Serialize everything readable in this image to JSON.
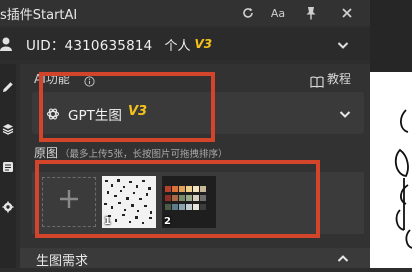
{
  "window": {
    "title": "s插件StartAI"
  },
  "account": {
    "uid": "UID：4310635814",
    "plan": "个人",
    "plan_badge": "V3"
  },
  "feature": {
    "label": "AI功能",
    "tutorial_label": "教程",
    "selected": "GPT生图",
    "selected_badge": "V3"
  },
  "upload": {
    "label": "原图",
    "hint": "（最多上传5张，长按图片可拖拽排序）",
    "images": [
      {
        "index": "1"
      },
      {
        "index": "2"
      }
    ]
  },
  "section_next": {
    "label": "生图需求"
  },
  "colors": {
    "accent_badge": "#f5c21b",
    "annotation": "#d2452a",
    "panel_bg": "#323232"
  },
  "icons": [
    "refresh-icon",
    "font-size-icon",
    "pin-icon",
    "close-icon",
    "user-icon",
    "chevron-down-icon",
    "edit-icon",
    "layers-icon",
    "history-icon",
    "gear-icon",
    "info-icon",
    "book-icon",
    "openai-icon",
    "plus-icon",
    "chevron-up-icon"
  ]
}
